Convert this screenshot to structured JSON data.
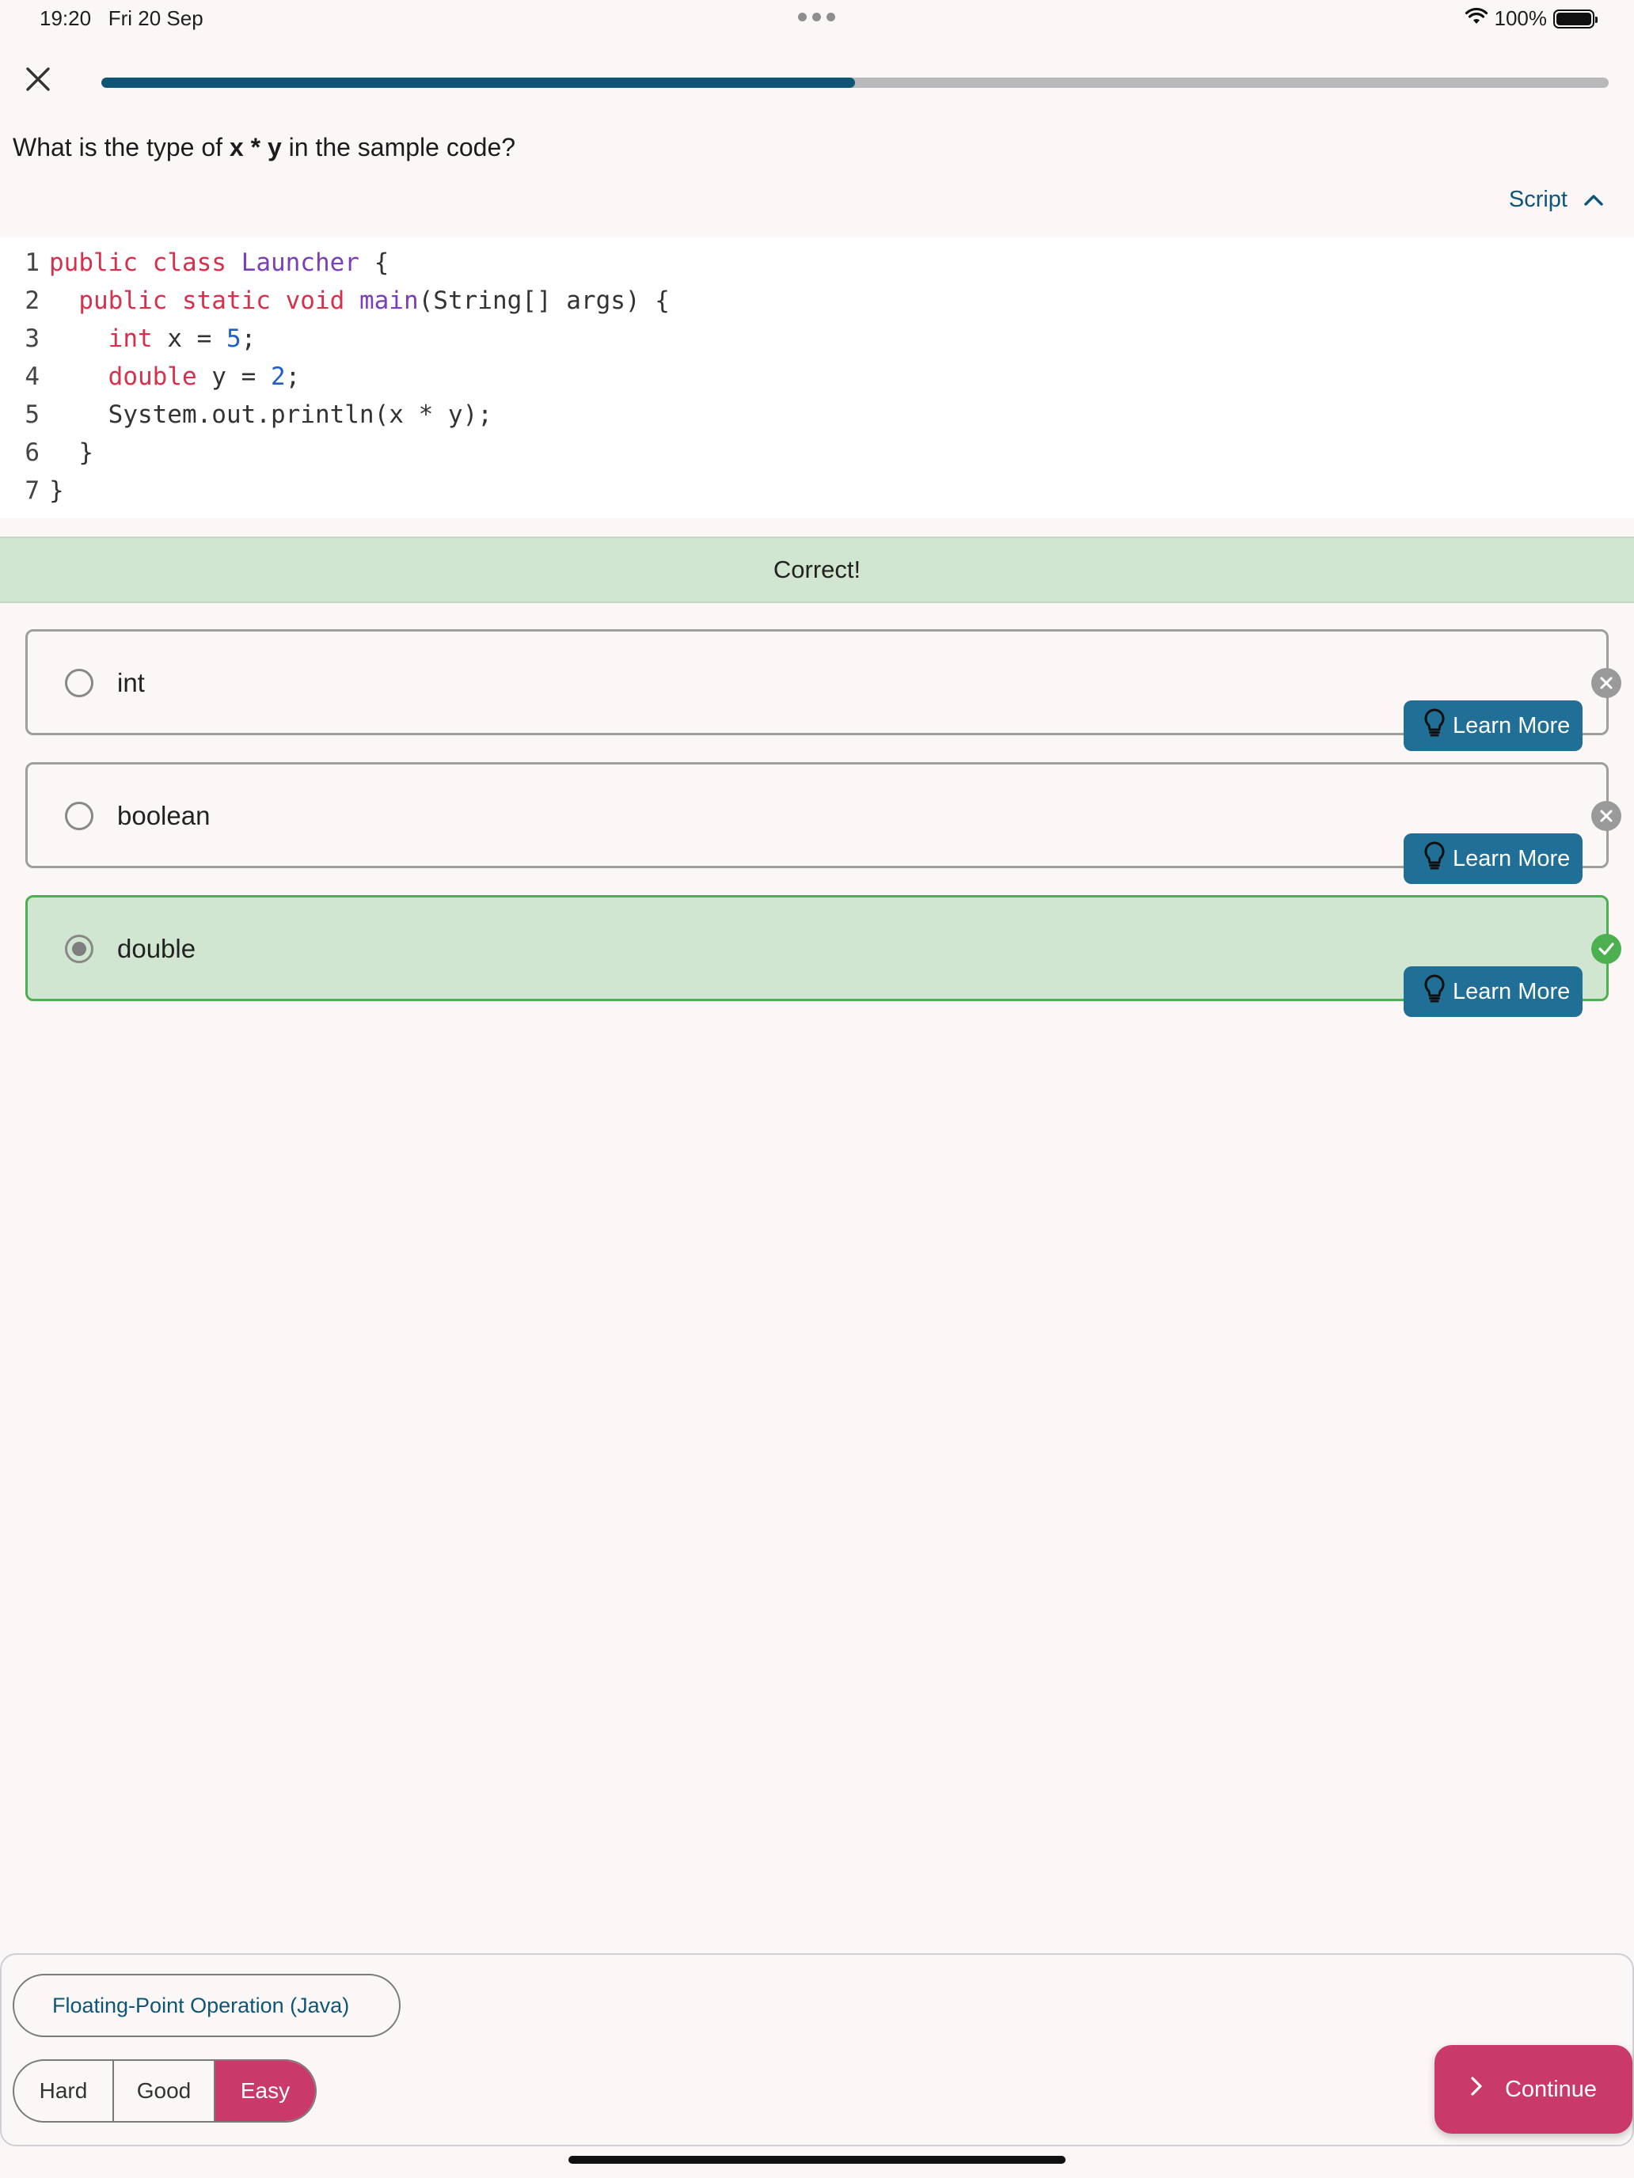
{
  "status_bar": {
    "time": "19:20",
    "date": "Fri 20 Sep",
    "battery": "100%"
  },
  "progress": {
    "fraction": 0.5
  },
  "question": {
    "prefix": "What is the type of ",
    "emphasis": "x * y",
    "suffix": " in the sample code?"
  },
  "script_toggle": {
    "label": "Script",
    "expanded": true
  },
  "code": {
    "lines": [
      {
        "num": "1",
        "indent": "",
        "tokens": [
          {
            "t": "public",
            "c": "kw"
          },
          {
            "t": " "
          },
          {
            "t": "class",
            "c": "kw"
          },
          {
            "t": " "
          },
          {
            "t": "Launcher",
            "c": "fn"
          },
          {
            "t": " {"
          }
        ]
      },
      {
        "num": "2",
        "indent": "  ",
        "tokens": [
          {
            "t": "public",
            "c": "kw"
          },
          {
            "t": " "
          },
          {
            "t": "static",
            "c": "kw"
          },
          {
            "t": " "
          },
          {
            "t": "void",
            "c": "kw"
          },
          {
            "t": " "
          },
          {
            "t": "main",
            "c": "fn"
          },
          {
            "t": "(String[] args) {"
          }
        ]
      },
      {
        "num": "3",
        "indent": "    ",
        "tokens": [
          {
            "t": "int",
            "c": "kw"
          },
          {
            "t": " x = "
          },
          {
            "t": "5",
            "c": "num"
          },
          {
            "t": ";"
          }
        ]
      },
      {
        "num": "4",
        "indent": "    ",
        "tokens": [
          {
            "t": "double",
            "c": "kw"
          },
          {
            "t": " y = "
          },
          {
            "t": "2",
            "c": "num"
          },
          {
            "t": ";"
          }
        ]
      },
      {
        "num": "5",
        "indent": "    ",
        "tokens": [
          {
            "t": "System.out.println(x * y);"
          }
        ]
      },
      {
        "num": "6",
        "indent": "  ",
        "tokens": [
          {
            "t": "}"
          }
        ]
      },
      {
        "num": "7",
        "indent": "",
        "tokens": [
          {
            "t": "}"
          }
        ]
      }
    ]
  },
  "result": {
    "text": "Correct!"
  },
  "options": [
    {
      "label": "int",
      "selected": false,
      "status": "wrong",
      "learn_more": "Learn More"
    },
    {
      "label": "boolean",
      "selected": false,
      "status": "wrong",
      "learn_more": "Learn More"
    },
    {
      "label": "double",
      "selected": true,
      "status": "correct",
      "learn_more": "Learn More"
    }
  ],
  "bottom": {
    "topic": "Floating-Point Operation (Java)",
    "difficulty": {
      "hard": "Hard",
      "good": "Good",
      "easy": "Easy",
      "selected": "Easy"
    },
    "continue_label": "Continue"
  },
  "colors": {
    "accent": "#0f5578",
    "correct_green": "#4caf50",
    "correct_bg": "#d1e6d1",
    "primary_pink": "#c93a6b",
    "learn_more_blue": "#1f6f97"
  }
}
